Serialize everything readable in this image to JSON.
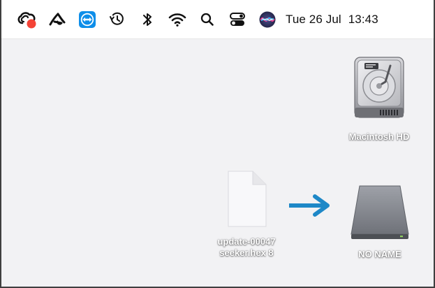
{
  "menubar": {
    "icons": [
      "creative-cloud-icon",
      "setapp-icon",
      "teamviewer-icon",
      "time-machine-icon",
      "bluetooth-icon",
      "wifi-icon",
      "spotlight-search-icon",
      "control-center-icon",
      "siri-icon"
    ],
    "date": "Tue 26 Jul",
    "time": "13:43"
  },
  "desktop": {
    "macintosh_hd": {
      "label": "Macintosh HD",
      "icon": "internal-hard-drive-icon"
    },
    "file": {
      "label_line1": "update-00047",
      "label_line2": "seeker.hex 8",
      "icon": "document-icon"
    },
    "arrow": {
      "icon": "right-arrow-icon",
      "color": "#1e88c7"
    },
    "no_name": {
      "label": "NO NAME",
      "icon": "external-drive-icon"
    }
  }
}
